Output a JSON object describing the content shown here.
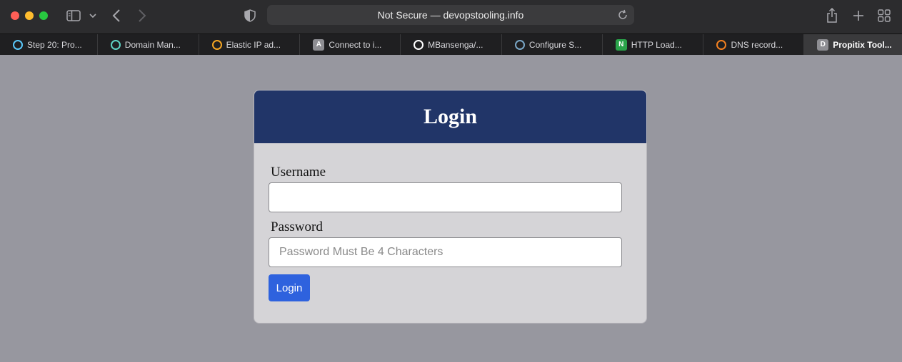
{
  "browser": {
    "address": "Not Secure — devopstooling.info",
    "tabs": [
      {
        "label": "Step 20: Pro...",
        "icon": "step-icon",
        "icon_color": "#5ac8fa"
      },
      {
        "label": "Domain Man...",
        "icon": "domain-icon",
        "icon_color": "#5fd3c4"
      },
      {
        "label": "Elastic IP ad...",
        "icon": "aws-icon",
        "icon_color": "#f5a623"
      },
      {
        "label": "Connect to i...",
        "icon": "letter-a-icon",
        "icon_text": "A",
        "icon_color": "#8e8e93"
      },
      {
        "label": "MBansenga/...",
        "icon": "github-icon",
        "icon_color": "#ffffff"
      },
      {
        "label": "Configure S...",
        "icon": "config-icon",
        "icon_color": "#7aa7c7"
      },
      {
        "label": "HTTP Load...",
        "icon": "nginx-icon",
        "icon_text": "N",
        "icon_color": "#2aa34a"
      },
      {
        "label": "DNS record...",
        "icon": "cloudflare-icon",
        "icon_color": "#f38020"
      },
      {
        "label": "Propitix Tool...",
        "icon": "letter-d-icon",
        "icon_text": "D",
        "icon_color": "#8e8e93",
        "active": true
      }
    ]
  },
  "login": {
    "title": "Login",
    "username_label": "Username",
    "username_value": "",
    "password_label": "Password",
    "password_placeholder": "Password Must Be 4 Characters",
    "button_label": "Login"
  },
  "colors": {
    "header_bg": "#213568",
    "button_bg": "#2e62de",
    "page_bg": "#97979f",
    "card_bg": "#d5d4d7"
  }
}
